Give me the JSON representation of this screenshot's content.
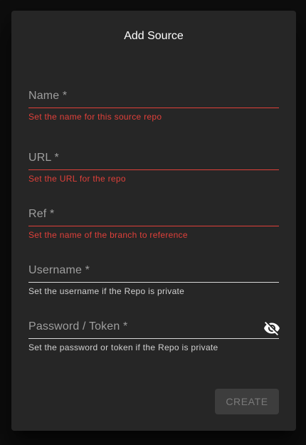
{
  "dialog": {
    "title": "Add Source"
  },
  "fields": {
    "name": {
      "label": "Name *",
      "value": "",
      "helper": "Set the name for this source repo",
      "state": "error"
    },
    "url": {
      "label": "URL *",
      "value": "",
      "helper": "Set the URL for the repo",
      "state": "error"
    },
    "ref": {
      "label": "Ref *",
      "value": "",
      "helper": "Set the name of the branch to reference",
      "state": "error"
    },
    "username": {
      "label": "Username *",
      "value": "",
      "helper": "Set the username if the Repo is private",
      "state": "normal"
    },
    "password": {
      "label": "Password / Token *",
      "value": "",
      "helper": "Set the password or token if the Repo is private",
      "state": "normal",
      "visibility_icon": "visibility-off-icon"
    }
  },
  "actions": {
    "create_label": "CREATE",
    "create_disabled": true
  },
  "colors": {
    "dialog_bg": "#262626",
    "error": "#e0403a",
    "label": "#9e9e9e",
    "helper": "#d0d0d0",
    "button_bg": "#3d3d3d",
    "button_text": "#7a7a7a"
  }
}
